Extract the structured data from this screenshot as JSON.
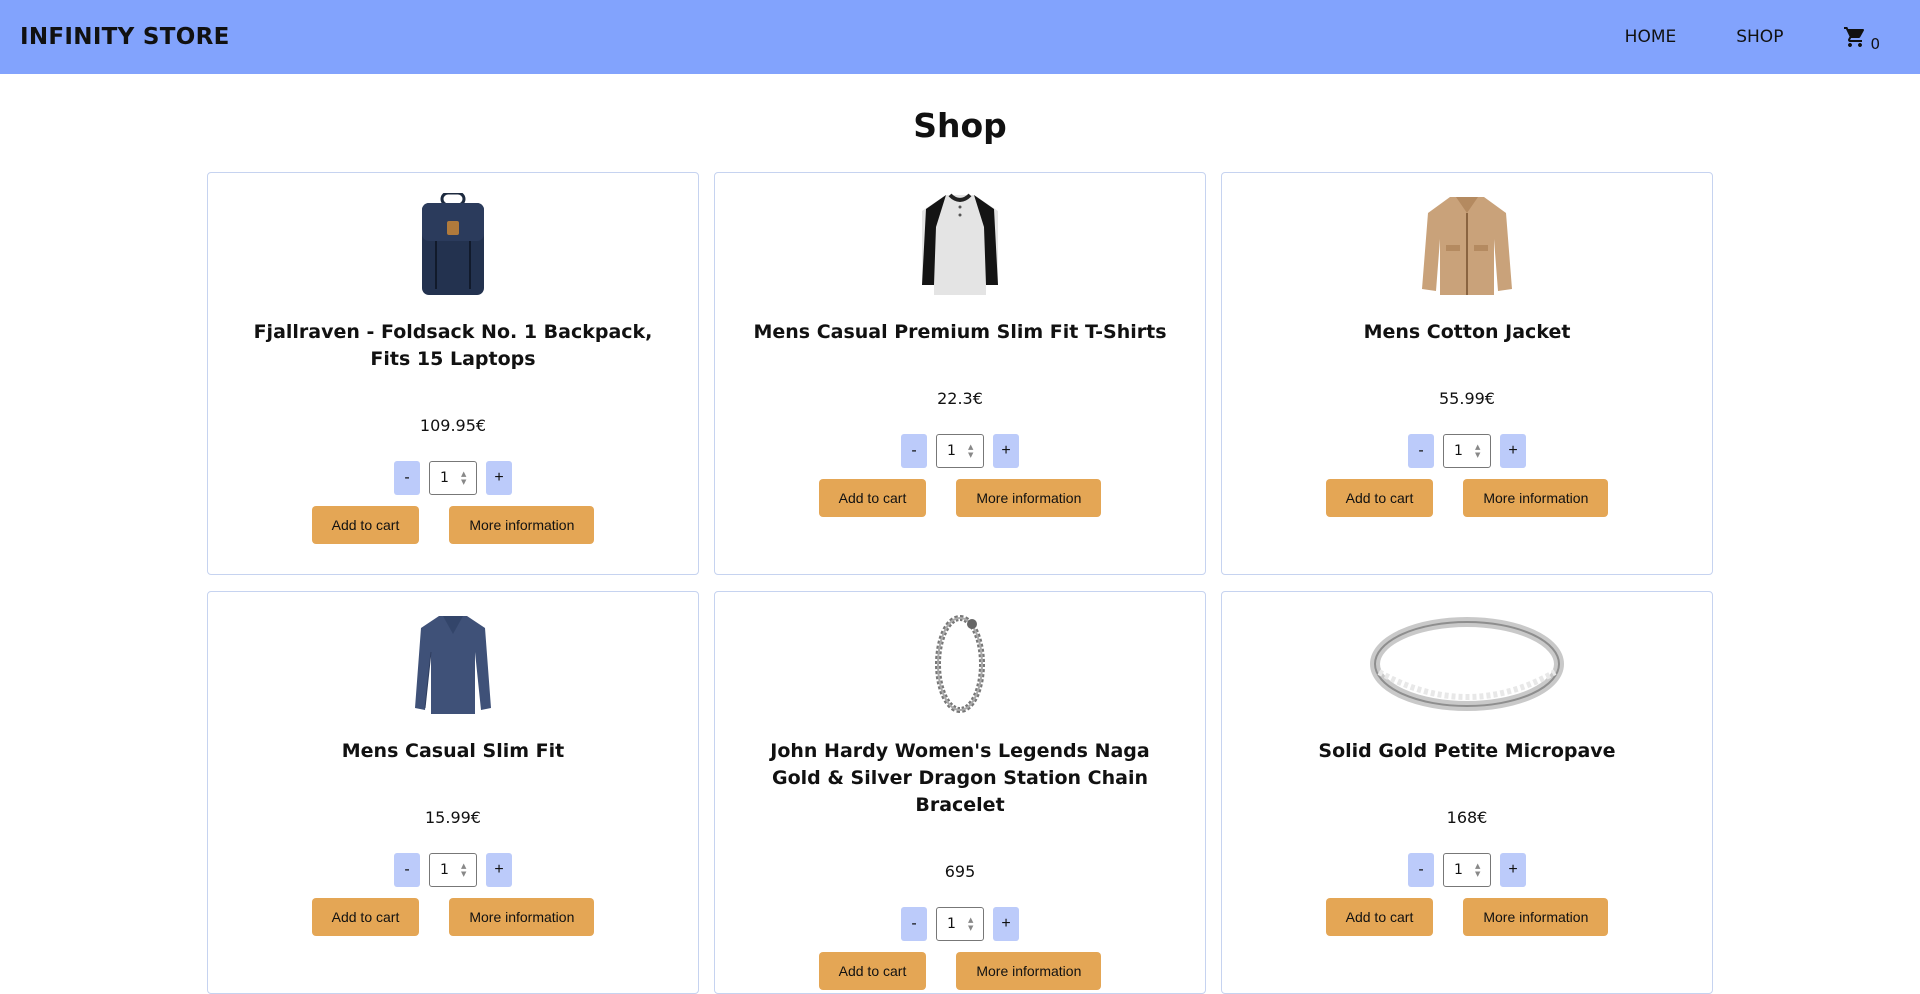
{
  "header": {
    "brand": "INFINITY STORE",
    "nav": [
      {
        "label": "HOME"
      },
      {
        "label": "SHOP"
      }
    ],
    "cart_count": "0",
    "cart_icon": "shopping-cart-icon"
  },
  "page": {
    "title": "Shop"
  },
  "labels": {
    "minus": "-",
    "plus": "+",
    "add_to_cart": "Add to cart",
    "more_info": "More information"
  },
  "products": [
    {
      "title": "Fjallraven - Foldsack No. 1 Backpack, Fits 15 Laptops",
      "price": "109.95€",
      "qty": "1",
      "image": "backpack"
    },
    {
      "title": "Mens Casual Premium Slim Fit T-Shirts",
      "price": "22.3€",
      "qty": "1",
      "image": "tshirt"
    },
    {
      "title": "Mens Cotton Jacket",
      "price": "55.99€",
      "qty": "1",
      "image": "jacket"
    },
    {
      "title": "Mens Casual Slim Fit",
      "price": "15.99€",
      "qty": "1",
      "image": "longsleeve"
    },
    {
      "title": "John Hardy Women's Legends Naga Gold & Silver Dragon Station Chain Bracelet",
      "price": "695",
      "qty": "1",
      "image": "bracelet"
    },
    {
      "title": "Solid Gold Petite Micropave",
      "price": "168€",
      "qty": "1",
      "image": "ring"
    }
  ]
}
